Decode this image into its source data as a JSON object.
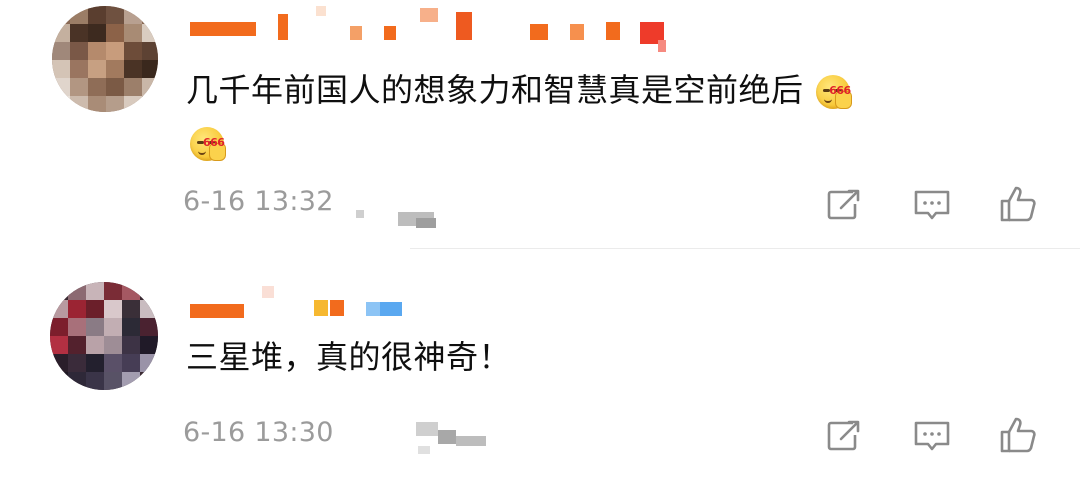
{
  "comments": [
    {
      "content": "几千年前国人的想象力和智慧真是空前绝后",
      "emoji": "666-emoji",
      "time": "6-16 13:32",
      "actions": {
        "share_icon": "share-icon",
        "reply_icon": "comment-icon",
        "like_icon": "thumbs-up-icon"
      }
    },
    {
      "content": "三星堆，真的很神奇！",
      "time": "6-16 13:30",
      "actions": {
        "share_icon": "share-icon",
        "reply_icon": "comment-icon",
        "like_icon": "thumbs-up-icon"
      }
    }
  ],
  "emoji_text": "666",
  "colors": {
    "username_orange": "#f26b1d",
    "username_red": "#ee3b2a",
    "username_yellow": "#f6b830",
    "username_blue": "#5aa8f0",
    "meta_gray": "#9b9b9b",
    "icon_gray": "#8a8a8a"
  }
}
